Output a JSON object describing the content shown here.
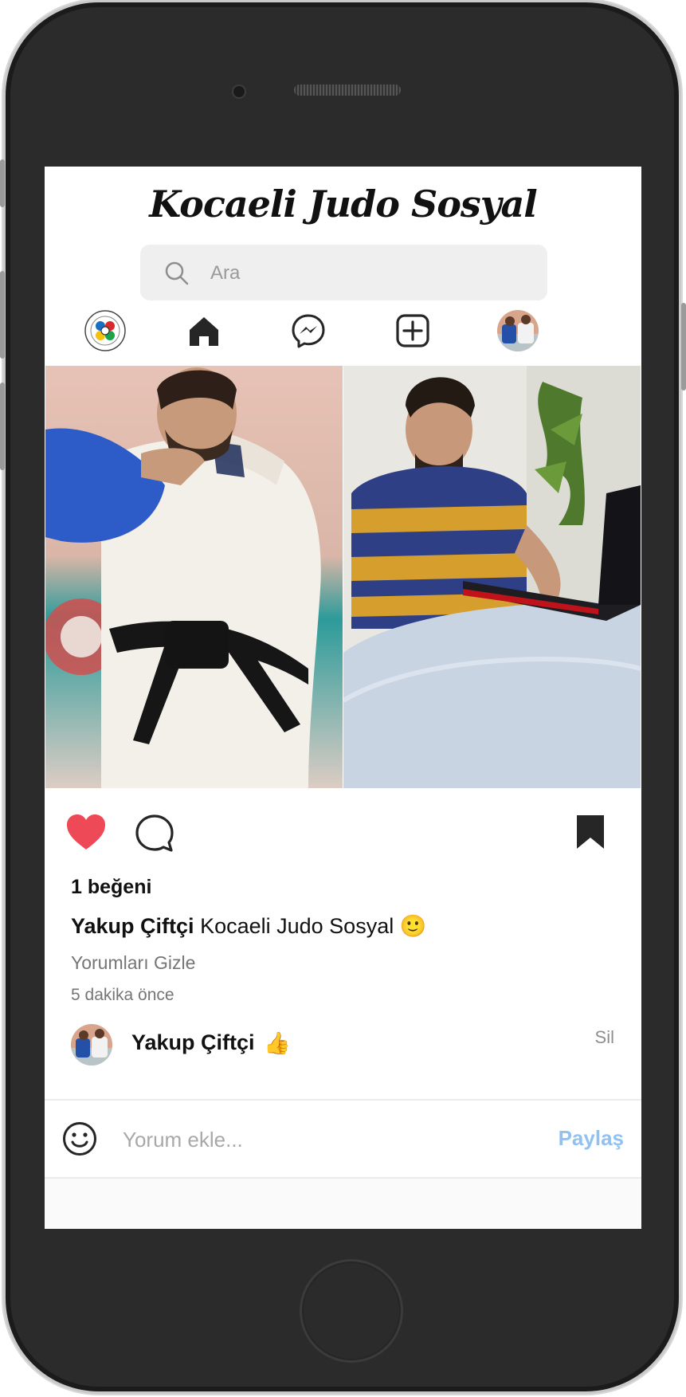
{
  "app": {
    "logo": "Kocaeli Judo Sosyal"
  },
  "search": {
    "placeholder": "Ara"
  },
  "nav": {
    "items": [
      {
        "name": "judo-federation-logo"
      },
      {
        "name": "home-icon"
      },
      {
        "name": "messenger-icon"
      },
      {
        "name": "add-post-icon"
      },
      {
        "name": "profile-avatar"
      }
    ]
  },
  "post": {
    "likes": "1 beğeni",
    "caption_user": "Yakup Çiftçi",
    "caption_text": "Kocaeli Judo Sosyal",
    "caption_emoji": "🙂",
    "hide_comments": "Yorumları Gizle",
    "time": "5 dakika önce",
    "liked": true,
    "saved": true,
    "colors": {
      "like": "#ed4956",
      "share": "#91c1ef"
    }
  },
  "comments": [
    {
      "user": "Yakup Çiftçi",
      "text": "👍",
      "delete_label": "Sil"
    }
  ],
  "add_comment": {
    "placeholder": "Yorum ekle...",
    "share_label": "Paylaş"
  }
}
